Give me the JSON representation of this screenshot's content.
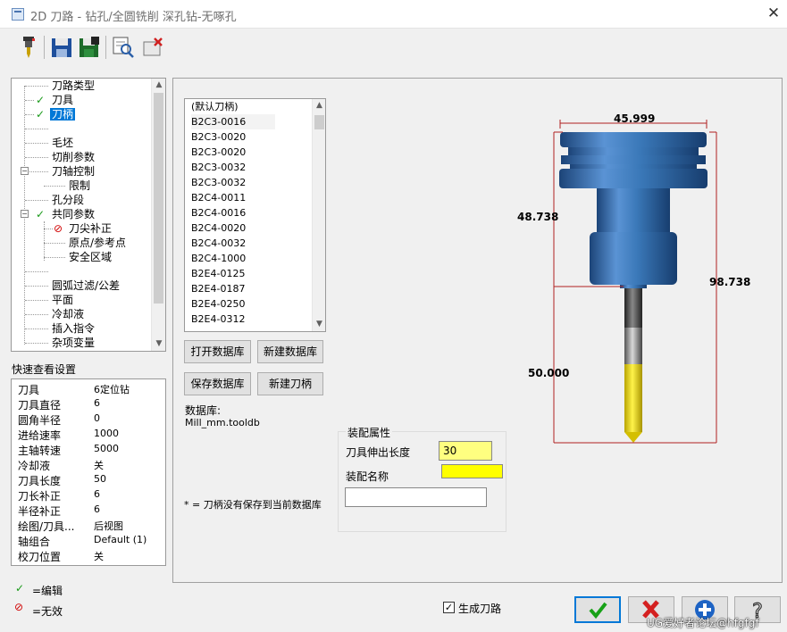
{
  "window": {
    "title": "2D 刀路 - 钻孔/全圆铣削 深孔钻-无啄孔",
    "close": "✕"
  },
  "toolbar": {
    "icons": [
      "tool-icon",
      "save-icon",
      "save-library-icon",
      "preview-icon",
      "clear-icon"
    ]
  },
  "tree": {
    "items": [
      {
        "label": "刀路类型",
        "mark": ""
      },
      {
        "label": "刀具",
        "mark": "✓"
      },
      {
        "label": "刀柄",
        "mark": "✓"
      },
      {
        "label": "",
        "mark": ""
      },
      {
        "label": "毛坯",
        "mark": ""
      },
      {
        "label": "切削参数",
        "mark": ""
      },
      {
        "label": "刀轴控制",
        "mark": ""
      },
      {
        "label": "限制",
        "mark": ""
      },
      {
        "label": "孔分段",
        "mark": ""
      },
      {
        "label": "共同参数",
        "mark": "✓"
      },
      {
        "label": "刀尖补正",
        "mark": "⊘"
      },
      {
        "label": "原点/参考点",
        "mark": ""
      },
      {
        "label": "安全区域",
        "mark": ""
      },
      {
        "label": "",
        "mark": ""
      },
      {
        "label": "圆弧过滤/公差",
        "mark": ""
      },
      {
        "label": "平面",
        "mark": ""
      },
      {
        "label": "冷却液",
        "mark": ""
      },
      {
        "label": "插入指令",
        "mark": ""
      },
      {
        "label": "杂项变量",
        "mark": ""
      }
    ],
    "selected": "刀柄"
  },
  "quick_view": {
    "title": "快速查看设置",
    "rows": [
      {
        "k": "刀具",
        "v": "6定位钻"
      },
      {
        "k": "刀具直径",
        "v": "6"
      },
      {
        "k": "圆角半径",
        "v": "0"
      },
      {
        "k": "进给速率",
        "v": "1000"
      },
      {
        "k": "主轴转速",
        "v": "5000"
      },
      {
        "k": "冷却液",
        "v": "关"
      },
      {
        "k": "刀具长度",
        "v": "50"
      },
      {
        "k": "刀长补正",
        "v": "6"
      },
      {
        "k": "半径补正",
        "v": "6"
      },
      {
        "k": "绘图/刀具...",
        "v": "后视图"
      },
      {
        "k": "轴组合",
        "v": "Default (1)"
      },
      {
        "k": "校刀位置",
        "v": "关"
      }
    ]
  },
  "legend": {
    "edit_mark": "✓",
    "edit": "=编辑",
    "invalid_mark": "⊘",
    "invalid": "=无效"
  },
  "holders": {
    "items": [
      "(默认刀柄)",
      "B2C3-0016",
      "B2C3-0020",
      "B2C3-0020",
      "B2C3-0032",
      "B2C3-0032",
      "B2C4-0011",
      "B2C4-0016",
      "B2C4-0020",
      "B2C4-0032",
      "B2C4-1000",
      "B2E4-0125",
      "B2E4-0187",
      "B2E4-0250",
      "B2E4-0312"
    ],
    "selected_index": 1
  },
  "buttons": {
    "open_db": "打开数据库",
    "new_db": "新建数据库",
    "save_db": "保存数据库",
    "new_holder": "新建刀柄"
  },
  "database": {
    "label": "数据库:",
    "name": "Mill_mm.tooldb"
  },
  "note": "* = 刀柄没有保存到当前数据库",
  "assembly": {
    "title": "装配属性",
    "extension_label": "刀具伸出长度",
    "extension_value": "30",
    "name_label": "装配名称",
    "name_value": "",
    "description_value": ""
  },
  "drawing": {
    "dim_top": "45.999",
    "dim_holder": "48.738",
    "dim_total": "98.738",
    "dim_tool": "50.000",
    "colors": {
      "holder": "#3a78b8",
      "dim": "#b02020",
      "tip": "#f2e000"
    }
  },
  "generate_toolpath": {
    "label": "生成刀路",
    "checked": true
  },
  "actions": {
    "ok": "ok-icon",
    "cancel": "cancel-icon",
    "add": "add-icon",
    "help": "help-icon"
  },
  "watermark": "UG爱好者论坛@hfgfgf"
}
